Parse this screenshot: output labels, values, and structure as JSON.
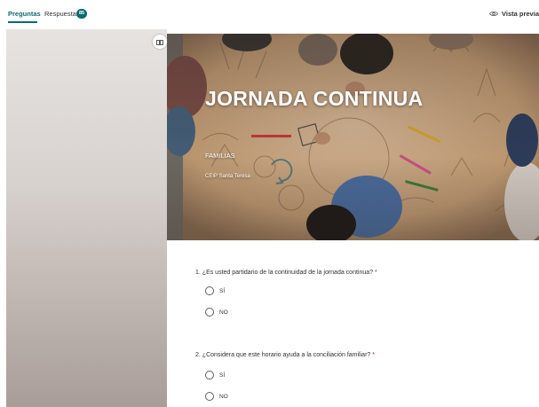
{
  "tabs": {
    "questions_label": "Preguntas",
    "responses_label": "Respuestas",
    "responses_count": "85",
    "preview_label": "Vista previa"
  },
  "form": {
    "title": "JORNADA CONTINUA",
    "subtitle": "FAMILIAS",
    "school": "CEIP Santa Teresa"
  },
  "questions": [
    {
      "number": "1.",
      "text": "¿Es usted partidario de la continuidad de la jornada continua?",
      "required_mark": "*",
      "options": [
        "SÍ",
        "NO"
      ]
    },
    {
      "number": "2.",
      "text": "¿Considera que este horario ayuda a la conciliación familiar?",
      "required_mark": "*",
      "options": [
        "SÍ",
        "NO"
      ]
    }
  ],
  "icons": {
    "preview": "eye-icon",
    "layout": "layout-columns-icon"
  },
  "colors": {
    "accent": "#0b6a6e",
    "required": "#a4262c"
  }
}
